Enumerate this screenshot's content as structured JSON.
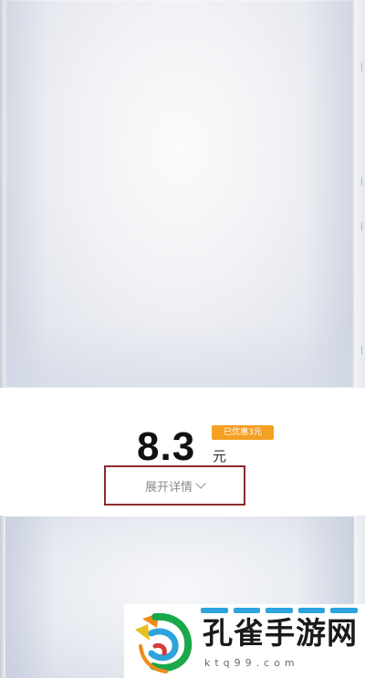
{
  "product": {
    "price": "8.3",
    "currency_unit": "元",
    "discount_badge": "已优惠3元",
    "expand_label": "展开详情"
  },
  "watermark": {
    "brand": "孔雀手游网",
    "site": "ktq99.com"
  },
  "colors": {
    "badge": "#f4a024",
    "highlight_border": "#8b2c2c",
    "watermark_accent": "#2ea4dd"
  },
  "icons": [
    "chevron-down-icon",
    "peacock-logo-icon"
  ]
}
